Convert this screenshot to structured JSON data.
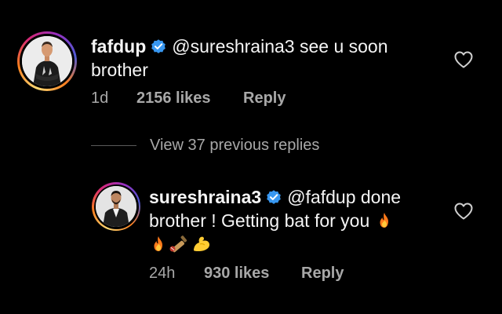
{
  "comments": [
    {
      "username": "fafdup",
      "mention": "@sureshraina3",
      "text": " see u soon brother",
      "time": "1d",
      "likes": "2156 likes",
      "reply_label": "Reply",
      "verified_icon": "verified-badge-icon",
      "like_icon": "heart-outline-icon"
    },
    {
      "username": "sureshraina3",
      "mention": "@fafdup",
      "text": " done brother ! Getting bat for you",
      "emojis": [
        "fire",
        "fire",
        "cricket-bat-and-ball",
        "flexed-biceps"
      ],
      "time": "24h",
      "likes": "930 likes",
      "reply_label": "Reply",
      "verified_icon": "verified-badge-icon",
      "like_icon": "heart-outline-icon"
    }
  ],
  "view_replies": {
    "label": "View 37 previous replies"
  },
  "colors": {
    "background": "#000000",
    "primary_text": "#f5f5f5",
    "secondary_text": "#a8a8a8",
    "verified_blue": "#3897f0",
    "divider": "#5a5a5a"
  }
}
